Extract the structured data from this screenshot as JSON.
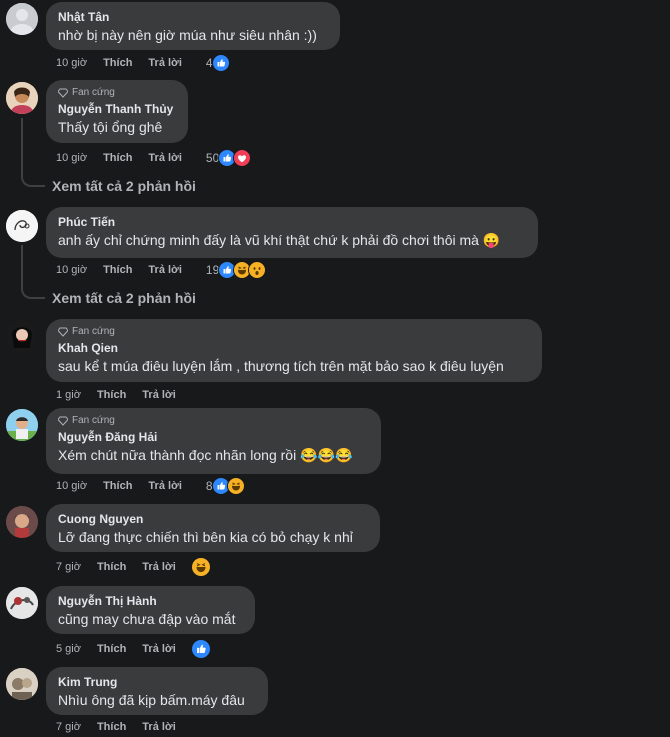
{
  "labels": {
    "fan_badge": "Fan cứng",
    "like": "Thích",
    "reply": "Trả lời"
  },
  "comments": [
    {
      "name": "Nhật Tân",
      "text": "nhờ bị này nên giờ múa như siêu nhân :))",
      "time": "10 giờ",
      "reactions": "4",
      "fan": false
    },
    {
      "name": "Nguyễn Thanh Thủy",
      "text": "Thấy tội ổng ghê",
      "time": "10 giờ",
      "reactions": "50",
      "fan": true
    },
    {
      "name": "Phúc Tiến",
      "text": "anh ấy chỉ chứng minh đấy là vũ khí thật chứ k phải đồ chơi thôi mà 😛",
      "time": "10 giờ",
      "reactions": "19",
      "fan": false
    },
    {
      "name": "Khah Qien",
      "text": "sau kể t múa điêu luyện lắm , thương tích trên mặt bảo sao k điêu luyện",
      "time": "1 giờ",
      "reactions": "",
      "fan": true
    },
    {
      "name": "Nguyễn Đăng Hải",
      "text": "Xém chút nữa thành đọc nhãn long rồi 😂😂😂",
      "time": "10 giờ",
      "reactions": "8",
      "fan": true
    },
    {
      "name": "Cuong Nguyen",
      "text": "Lỡ đang thực chiến thì bên kia có bỏ chạy k nhỉ",
      "time": "7 giờ",
      "reactions": "",
      "fan": false
    },
    {
      "name": "Nguyễn Thị Hành",
      "text": "cũng may chưa đập vào mắt",
      "time": "5 giờ",
      "reactions": "",
      "fan": false
    },
    {
      "name": "Kim Trung",
      "text": "Nhìu ông đã kịp bấm.máy đâu",
      "time": "7 giờ",
      "reactions": "",
      "fan": false
    }
  ],
  "view_replies": [
    "Xem tất cả 2 phản hồi",
    "Xem tất cả 2 phản hồi"
  ],
  "colors": {
    "like_blue": "#2d88ff",
    "love_red": "#f33e58",
    "haha_yellow": "#f7b125"
  }
}
